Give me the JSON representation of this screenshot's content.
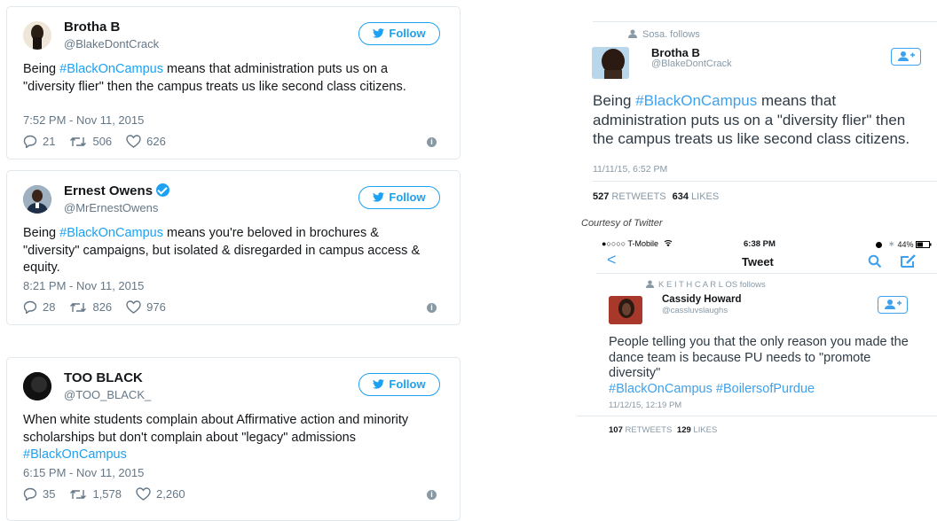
{
  "tweets": [
    {
      "name": "Brotha B",
      "handle": "@BlakeDontCrack",
      "follow_label": "Follow",
      "text_before": "Being ",
      "hashtag": "#BlackOnCampus",
      "text_after": " means that administration puts us on a \"diversity flier\" then the campus treats us like second class citizens.",
      "time": "7:52 PM - Nov 11, 2015",
      "replies": "21",
      "retweets": "506",
      "likes": "626"
    },
    {
      "name": "Ernest Owens",
      "handle": "@MrErnestOwens",
      "follow_label": "Follow",
      "text_before": "Being ",
      "hashtag": "#BlackOnCampus",
      "text_after": " means you're beloved in brochures & \"diversity\" campaigns, but isolated & disregarded in campus access & equity.",
      "time": "8:21 PM - Nov 11, 2015",
      "replies": "28",
      "retweets": "826",
      "likes": "976"
    },
    {
      "name": "TOO BLACK",
      "handle": "@TOO_BLACK_",
      "follow_label": "Follow",
      "text_before": "When white students complain about Affirmative action and minority scholarships but don't complain about \"legacy\" admissions ",
      "hashtag": "#BlackOnCampus",
      "text_after": "",
      "time": "6:15 PM - Nov 11, 2015",
      "replies": "35",
      "retweets": "1,578",
      "likes": "2,260"
    }
  ],
  "phone1": {
    "followed_by": "Sosa. follows",
    "name": "Brotha B",
    "handle": "@BlakeDontCrack",
    "text_before": "Being ",
    "hashtag": "#BlackOnCampus",
    "text_after": " means that administration puts us on a \"diversity flier\" then the campus treats us like second class citizens.",
    "date": "11/11/15, 6:52 PM",
    "retweets_count": "527",
    "retweets_label": "RETWEETS",
    "likes_count": "634",
    "likes_label": "LIKES"
  },
  "caption": "Courtesy of Twitter",
  "phone2": {
    "carrier": "●○○○○ T-Mobile",
    "clock": "6:38 PM",
    "battery": "44%",
    "back_label": "<",
    "title": "Tweet",
    "followed_by": "K E I T H  C A R L OS follows",
    "name": "Cassidy Howard",
    "handle": "@cassluvslaughs",
    "text": "People telling you that the only reason you made the dance team is because PU needs to \"promote diversity\"",
    "hashtag1": "#BlackOnCampus",
    "hashtag2": "#BoilersofPurdue",
    "date": "11/12/15, 12:19 PM",
    "retweets_count": "107",
    "retweets_label": "RETWEETS",
    "likes_count": "129",
    "likes_label": "LIKES"
  },
  "colors": {
    "twitter_blue": "#1da1f2",
    "muted": "#657786"
  }
}
